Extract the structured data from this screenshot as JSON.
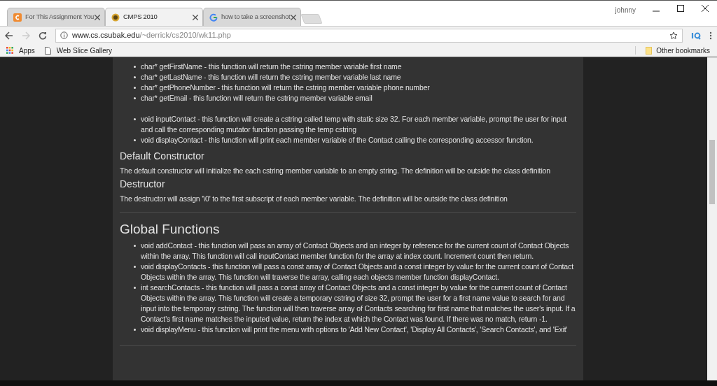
{
  "window": {
    "user": "johnny"
  },
  "tabs": [
    {
      "title": "For This Assignment You",
      "selected": false
    },
    {
      "title": "CMPS 2010",
      "selected": true
    },
    {
      "title": "how to take a screenshot",
      "selected": false
    }
  ],
  "address_bar": {
    "host": "www.cs.csubak.edu",
    "path": "/~derrick/cs2010/wk11.php"
  },
  "bookmarks": [
    {
      "label": "Apps",
      "kind": "apps"
    },
    {
      "label": "Web Slice Gallery",
      "kind": "page"
    }
  ],
  "other_bookmarks": "Other bookmarks",
  "content": [
    {
      "kind": "list",
      "items": [
        "char* getFirstName - this function will return the cstring member variable first name",
        "char* getLastName - this function will return the cstring member variable last name",
        "char* getPhoneNumber - this function will return the cstring member variable phone number",
        "char* getEmail - this function will return the cstring member variable email"
      ]
    },
    {
      "kind": "list",
      "items": [
        "void inputContact - this function will create a cstring called temp with static size 32. For each member variable, prompt the user for input and call the corresponding mutator function passing the temp cstring",
        "void displayContact - this function will print each member variable of the Contact calling the corresponding accessor function."
      ]
    },
    {
      "kind": "heading",
      "text": "Default Constructor"
    },
    {
      "kind": "paragraph",
      "text": "The default constructor will initialize the each cstring member variable to an empty string. The definition will be outside the class definition"
    },
    {
      "kind": "heading",
      "text": "Destructor"
    },
    {
      "kind": "paragraph",
      "text": "The destructor will assign '\\0' to the first subscript of each member variable. The definition will be outside the class definition"
    },
    {
      "kind": "rule"
    },
    {
      "kind": "title",
      "text": "Global Functions"
    },
    {
      "kind": "list",
      "items": [
        "void addContact - this function will pass an array of Contact Objects and an integer by reference for the current count of Contact Objects within the array. This function will call inputContact member function for the array at index count. Increment count then return.",
        "void displayContacts - this function will pass a const array of Contact Objects and a const integer by value for the current count of Contact Objects within the array. This function will traverse the array, calling each objects member function displayContact.",
        "int searchContacts - this function will pass a const array of Contact Objects and a const integer by value for the current count of Contact Objects within the array. This function will create a temporary cstring of size 32, prompt the user for a first name value to search for and input into the temporary cstring. The function will then traverse array of Contacts searching for first name that matches the user's input. If a Contact's first name matches the inputed value, return the index at which the Contact was found. If there was no match, return -1.",
        "void displayMenu - this function will print the menu with options to 'Add New Contact', 'Display All Contacts', 'Search Contacts', and 'Exit'"
      ]
    },
    {
      "kind": "rule"
    }
  ]
}
